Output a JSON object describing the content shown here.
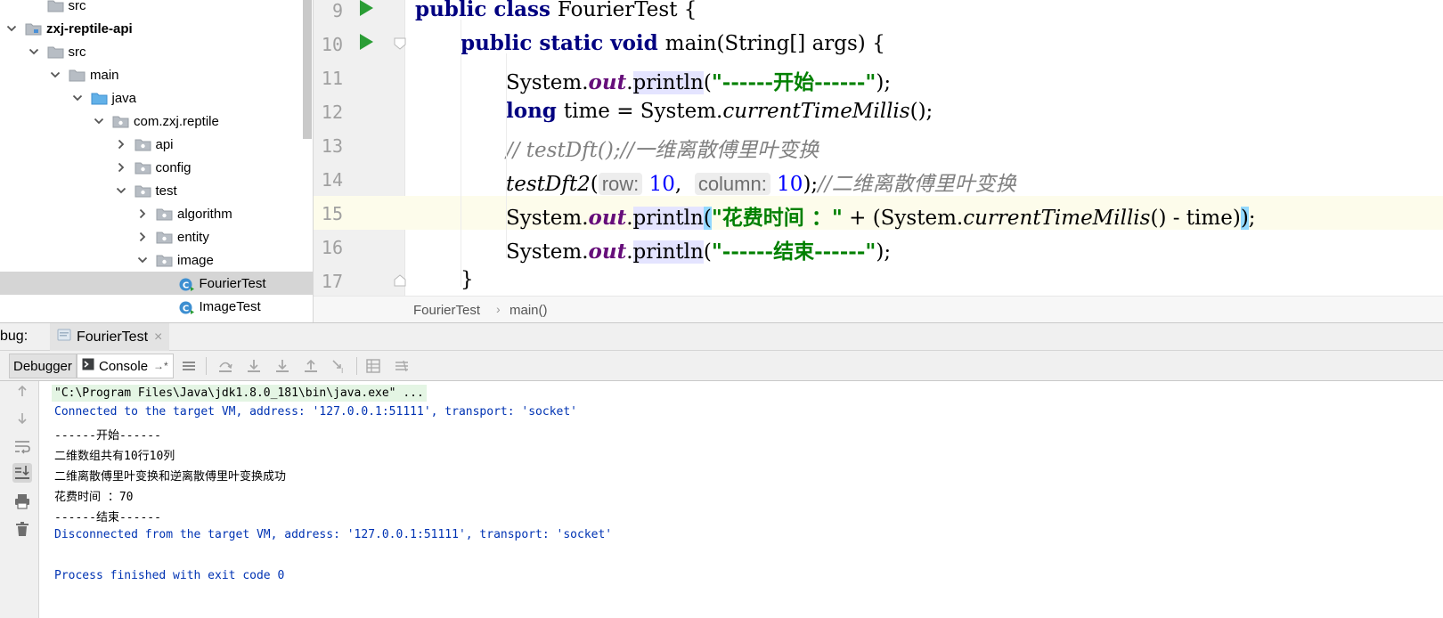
{
  "project_tree": {
    "items": [
      {
        "label": "src",
        "type": "folder",
        "arrow": "none",
        "indent": 1,
        "bold": false,
        "selected": false
      },
      {
        "label": "zxj-reptile-api",
        "type": "module",
        "arrow": "expanded",
        "indent": 0,
        "bold": true,
        "selected": false
      },
      {
        "label": "src",
        "type": "folder",
        "arrow": "expanded",
        "indent": 1,
        "bold": false,
        "selected": false
      },
      {
        "label": "main",
        "type": "folder",
        "arrow": "expanded",
        "indent": 2,
        "bold": false,
        "selected": false
      },
      {
        "label": "java",
        "type": "source-folder",
        "arrow": "expanded",
        "indent": 3,
        "bold": false,
        "selected": false
      },
      {
        "label": "com.zxj.reptile",
        "type": "package",
        "arrow": "expanded",
        "indent": 4,
        "bold": false,
        "selected": false
      },
      {
        "label": "api",
        "type": "package",
        "arrow": "collapsed",
        "indent": 5,
        "bold": false,
        "selected": false
      },
      {
        "label": "config",
        "type": "package",
        "arrow": "collapsed",
        "indent": 5,
        "bold": false,
        "selected": false
      },
      {
        "label": "test",
        "type": "package",
        "arrow": "expanded",
        "indent": 5,
        "bold": false,
        "selected": false
      },
      {
        "label": "algorithm",
        "type": "package",
        "arrow": "collapsed",
        "indent": 6,
        "bold": false,
        "selected": false
      },
      {
        "label": "entity",
        "type": "package",
        "arrow": "collapsed",
        "indent": 6,
        "bold": false,
        "selected": false
      },
      {
        "label": "image",
        "type": "package",
        "arrow": "expanded",
        "indent": 6,
        "bold": false,
        "selected": false
      },
      {
        "label": "FourierTest",
        "type": "class",
        "arrow": "none",
        "indent": 7,
        "bold": false,
        "selected": true
      },
      {
        "label": "ImageTest",
        "type": "class",
        "arrow": "none",
        "indent": 7,
        "bold": false,
        "selected": false
      }
    ]
  },
  "editor": {
    "lines": [
      {
        "num": "9",
        "run": true,
        "fold": false,
        "current": false,
        "indent": 0,
        "tokens": [
          {
            "t": "public class ",
            "c": "kw"
          },
          {
            "t": "FourierTest {",
            "c": "plain"
          }
        ]
      },
      {
        "num": "10",
        "run": true,
        "fold": true,
        "current": false,
        "indent": 1,
        "tokens": [
          {
            "t": "public static void ",
            "c": "kw"
          },
          {
            "t": "main(String[] args) {",
            "c": "plain"
          }
        ]
      },
      {
        "num": "11",
        "run": false,
        "fold": false,
        "current": false,
        "indent": 2,
        "tokens": [
          {
            "t": "System.",
            "c": "plain"
          },
          {
            "t": "out",
            "c": "field"
          },
          {
            "t": ".",
            "c": "plain"
          },
          {
            "t": "println",
            "c": "call-hl"
          },
          {
            "t": "(",
            "c": "plain"
          },
          {
            "t": "\"------开始------\"",
            "c": "str"
          },
          {
            "t": ");",
            "c": "plain"
          }
        ]
      },
      {
        "num": "12",
        "run": false,
        "fold": false,
        "current": false,
        "indent": 2,
        "tokens": [
          {
            "t": "long ",
            "c": "kw"
          },
          {
            "t": "time = System.",
            "c": "plain"
          },
          {
            "t": "currentTimeMillis",
            "c": "static-m"
          },
          {
            "t": "();",
            "c": "plain"
          }
        ]
      },
      {
        "num": "13",
        "run": false,
        "fold": false,
        "current": false,
        "indent": 2,
        "tokens": [
          {
            "t": "// testDft();//一维离散傅里叶变换",
            "c": "comment"
          }
        ]
      },
      {
        "num": "14",
        "run": false,
        "fold": false,
        "current": false,
        "indent": 2,
        "tokens": [
          {
            "t": "testDft2",
            "c": "static-m"
          },
          {
            "t": "(",
            "c": "plain"
          },
          {
            "t": "row:",
            "c": "hint"
          },
          {
            "t": " ",
            "c": "plain"
          },
          {
            "t": "10",
            "c": "num"
          },
          {
            "t": ",  ",
            "c": "plain"
          },
          {
            "t": "column:",
            "c": "hint"
          },
          {
            "t": " ",
            "c": "plain"
          },
          {
            "t": "10",
            "c": "num"
          },
          {
            "t": ");",
            "c": "plain"
          },
          {
            "t": "//二维离散傅里叶变换",
            "c": "comment"
          }
        ]
      },
      {
        "num": "15",
        "run": false,
        "fold": false,
        "current": true,
        "indent": 2,
        "tokens": [
          {
            "t": "System.",
            "c": "plain"
          },
          {
            "t": "out",
            "c": "field"
          },
          {
            "t": ".",
            "c": "plain"
          },
          {
            "t": "println",
            "c": "call-hl"
          },
          {
            "t": "(",
            "c": "brace-hl"
          },
          {
            "t": "\"花费时间 ：\"",
            "c": "str"
          },
          {
            "t": " + (System.",
            "c": "plain"
          },
          {
            "t": "currentTimeMillis",
            "c": "static-m"
          },
          {
            "t": "() - time)",
            "c": "plain"
          },
          {
            "t": ")",
            "c": "brace-hl"
          },
          {
            "t": ";",
            "c": "plain"
          }
        ]
      },
      {
        "num": "16",
        "run": false,
        "fold": false,
        "current": false,
        "indent": 2,
        "tokens": [
          {
            "t": "System.",
            "c": "plain"
          },
          {
            "t": "out",
            "c": "field"
          },
          {
            "t": ".",
            "c": "plain"
          },
          {
            "t": "println",
            "c": "call-hl"
          },
          {
            "t": "(",
            "c": "plain"
          },
          {
            "t": "\"------结束------\"",
            "c": "str"
          },
          {
            "t": ");",
            "c": "plain"
          }
        ]
      },
      {
        "num": "17",
        "run": false,
        "fold": true,
        "current": false,
        "indent": 1,
        "tokens": [
          {
            "t": "}",
            "c": "plain"
          }
        ]
      }
    ]
  },
  "breadcrumb": {
    "class_name": "FourierTest",
    "separator": "›",
    "method_name": "main()"
  },
  "debug": {
    "title": "bug:",
    "session_tab": "FourierTest",
    "session_close": "×",
    "tabs": {
      "debugger": "Debugger",
      "console": "Console",
      "console_pin": "→*"
    }
  },
  "console": {
    "lines": [
      {
        "text": "\"C:\\Program Files\\Java\\jdk1.8.0_181\\bin\\java.exe\" ...",
        "kind": "cmd"
      },
      {
        "text": "Connected to the target VM, address: '127.0.0.1:51111', transport: 'socket'",
        "kind": "sys"
      },
      {
        "text": "------开始------",
        "kind": "out"
      },
      {
        "text": "二维数组共有10行10列",
        "kind": "out"
      },
      {
        "text": "二维离散傅里叶变换和逆离散傅里叶变换成功",
        "kind": "out"
      },
      {
        "text": "花费时间 ：70",
        "kind": "out"
      },
      {
        "text": "------结束------",
        "kind": "out"
      },
      {
        "text": "Disconnected from the target VM, address: '127.0.0.1:51111', transport: 'socket'",
        "kind": "sys"
      },
      {
        "text": "",
        "kind": "out"
      },
      {
        "text": "Process finished with exit code 0",
        "kind": "sys"
      }
    ]
  },
  "colors": {
    "keyword": "#000080",
    "string": "#008000",
    "field": "#660e7a",
    "comment": "#808080",
    "number": "#0000ff",
    "console_system": "#0033b3",
    "run_icon": "#2a9d35",
    "current_line": "#fdfceb"
  }
}
